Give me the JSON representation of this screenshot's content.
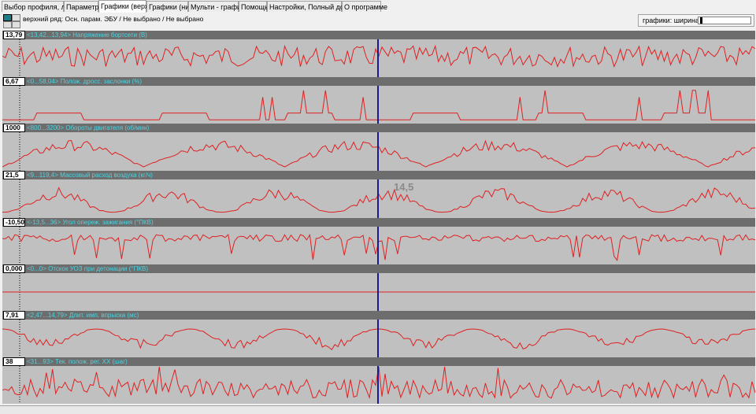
{
  "tabs": [
    {
      "label": "Выбор профиля, лога",
      "active": false
    },
    {
      "label": "Параметры",
      "active": false
    },
    {
      "label": "Графики (верх)",
      "active": true
    },
    {
      "label": "Графики (низ)",
      "active": false
    },
    {
      "label": "Мульти - график",
      "active": false
    },
    {
      "label": "Помощь",
      "active": false
    },
    {
      "label": "Настройки, Полный доступ",
      "active": false
    },
    {
      "label": "О программе",
      "active": false
    }
  ],
  "toolbar": {
    "status_text": "верхний ряд: Осн. парам. ЭБУ / Не выбрано / Не выбрано",
    "width_label": "графики:  ширина:",
    "width_level": 0.03
  },
  "colors": {
    "trace": "#e02020",
    "cursor": "#1a1a8c",
    "plot_bg": "#c0c0c0",
    "header_bg": "#6d6d6d",
    "title_text": "#4fd3e0"
  },
  "annotation": {
    "text": "14,5"
  },
  "cursor": {
    "position_fraction": 0.5
  },
  "panels": [
    {
      "value": "13,79",
      "title": "<13,42...13,94> Напряжение бортсети (В)",
      "shape": "noisy"
    },
    {
      "value": "6,67",
      "title": "<0...58,04> Полож. дросс. заслонки (%)",
      "shape": "throttle"
    },
    {
      "value": "1000",
      "title": "<800...3200> Обороты двигателя (об/мин)",
      "shape": "rpm"
    },
    {
      "value": "21,5",
      "title": "<9...119,4> Массовый расход воздуха (кг/ч)",
      "shape": "maf"
    },
    {
      "value": "-10,50",
      "title": "<-13,5...36> Угол опереж. зажигания (°ПКВ)",
      "shape": "ign"
    },
    {
      "value": "0,000",
      "title": "<0...0> Отскок УОЗ при детонации (°ПКВ)",
      "shape": "flat"
    },
    {
      "value": "7,91",
      "title": "<2,47...14,79> Длит. имп. впрыска (мс)",
      "shape": "inj"
    },
    {
      "value": "38",
      "title": "<31...93> Тек. полож. рег. XX (шаг)",
      "shape": "iac"
    }
  ]
}
